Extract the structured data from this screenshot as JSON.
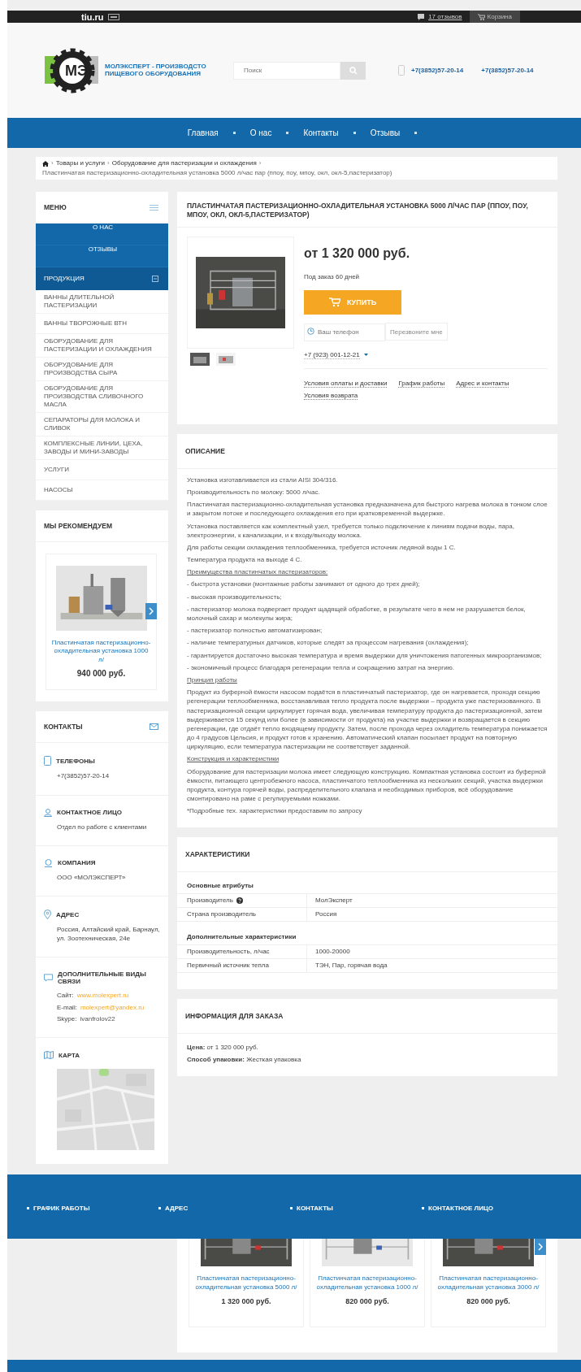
{
  "topbar": {
    "logo": "tiu.ru",
    "reviews": "17 отзывов",
    "cart": "Корзина"
  },
  "header": {
    "logo_letters": "МЭ",
    "company": "МОЛЭКСПЕРТ - ПРОИЗВОДСТО ПИЩЕВОГО ОБОРУДОВАНИЯ",
    "search": {
      "placeholder": "Поиск"
    },
    "phones": [
      "+7(3852)57-20-14",
      "+7(3852)57-20-14"
    ]
  },
  "nav": [
    "Главная",
    "О нас",
    "Контакты",
    "Отзывы"
  ],
  "breadcrumb": {
    "separator": "›",
    "items": [
      "Товары и услуги",
      "Оборудование для пастеризации и охлаждения",
      "Пластинчатая пастеризационно-охладительная установка 5000 л/час пар (ппоу, поу, мпоу, окл, окл-5,пастеризатор)"
    ]
  },
  "menu": {
    "title": "МЕНЮ",
    "items": [
      {
        "label": "О НАС",
        "kind": "main"
      },
      {
        "label": "ОТЗЫВЫ",
        "kind": "main"
      },
      {
        "label": "ПРОДУКЦИЯ",
        "kind": "group",
        "expanded": true
      },
      {
        "label": "ВАННЫ ДЛИТЕЛЬНОЙ ПАСТЕРИЗАЦИИ",
        "kind": "sub"
      },
      {
        "label": "ВАННЫ ТВОРОЖНЫЕ ВТН",
        "kind": "sub"
      },
      {
        "label": "ОБОРУДОВАНИЕ ДЛЯ ПАСТЕРИЗАЦИИ И ОХЛАЖДЕНИЯ",
        "kind": "sub"
      },
      {
        "label": "ОБОРУДОВАНИЕ ДЛЯ ПРОИЗВОДСТВА СЫРА",
        "kind": "sub"
      },
      {
        "label": "ОБОРУДОВАНИЕ ДЛЯ ПРОИЗВОДСТВА СЛИВОЧНОГО МАСЛА",
        "kind": "sub"
      },
      {
        "label": "СЕПАРАТОРЫ ДЛЯ МОЛОКА И СЛИВОК",
        "kind": "sub"
      },
      {
        "label": "КОМПЛЕКСНЫЕ ЛИНИИ, ЦЕХА, ЗАВОДЫ И МИНИ-ЗАВОДЫ",
        "kind": "sub"
      },
      {
        "label": "УСЛУГИ",
        "kind": "sub"
      },
      {
        "label": "НАСОСЫ",
        "kind": "sub"
      }
    ]
  },
  "recommend": {
    "title": "МЫ РЕКОМЕНДУЕМ",
    "product": {
      "title": "Пластинчатая пастеризационно-охладительная установка 1000 л/",
      "price": "940 000 руб."
    }
  },
  "contacts": {
    "title": "КОНТАКТЫ",
    "sections": [
      {
        "kind": "phone",
        "title": "ТЕЛЕФОНЫ",
        "lines": [
          "+7(3852)57-20-14"
        ]
      },
      {
        "kind": "person",
        "title": "КОНТАКТНОЕ ЛИЦО",
        "lines": [
          "Отдел по работе с клиентами"
        ]
      },
      {
        "kind": "company",
        "title": "КОМПАНИЯ",
        "lines": [
          "ООО «МОЛЭКСПЕРТ»"
        ]
      },
      {
        "kind": "address",
        "title": "АДРЕС",
        "lines": [
          "Россия, Алтайский край, Барнаул, ул. Зоотехническая, 24е"
        ]
      },
      {
        "kind": "chat",
        "title": "ДОПОЛНИТЕЛЬНЫЕ ВИДЫ СВЯЗИ",
        "links": [
          {
            "label": "Сайт:",
            "value": "www.molexpert.ru",
            "plain": false
          },
          {
            "label": "E-mail:",
            "value": "molexpert@yandex.ru",
            "plain": false
          },
          {
            "label": "Skype:",
            "value": "ivanfrolov22",
            "plain": true
          }
        ]
      },
      {
        "kind": "map",
        "title": "КАРТА"
      }
    ]
  },
  "product": {
    "title": "ПЛАСТИНЧАТАЯ ПАСТЕРИЗАЦИОННО-ОХЛАДИТЕЛЬНАЯ УСТАНОВКА 5000 Л/ЧАС ПАР (ППОУ, ПОУ, МПОУ, ОКЛ, ОКЛ-5,ПАСТЕРИЗАТОР)",
    "price": "от 1 320 000 руб.",
    "availability": "Под заказ 60 дней",
    "buy": "КУПИТЬ",
    "phone_field": {
      "placeholder": "Ваш телефон"
    },
    "callback": "Перезвоните мне",
    "phone": "+7 (923) 001-12-21",
    "links": [
      "Условия оплаты и доставки",
      "График работы",
      "Адрес и контакты",
      "Условия возврата"
    ]
  },
  "description": {
    "title": "ОПИСАНИЕ",
    "paragraphs": [
      {
        "kind": "text",
        "text": "Установка изготавливается из стали AISI 304/316."
      },
      {
        "kind": "text",
        "text": "Производительность по молоку: 5000 л/час."
      },
      {
        "kind": "text",
        "text": "Пластинчатая пастеризационно-охладительная установка предназначена для быстрого нагрева молока в тонком слое и закрытом потоке и последующего охлаждения его при кратковременной выдержке."
      },
      {
        "kind": "text",
        "text": "Установка поставляется как комплектный узел, требуется только подключение к линиям подачи воды, пара, электроэнергии, к канализации, и к входу/выходу молока."
      },
      {
        "kind": "text",
        "text": "Для работы секции охлаждения теплообменника, требуется источник ледяной воды 1 С."
      },
      {
        "kind": "text",
        "text": "Температура продукта на выходе 4 С."
      },
      {
        "kind": "heading",
        "text": "Преимущества пластинчатых пастеризаторов:"
      },
      {
        "kind": "text",
        "text": "- быстрота установки (монтажные работы занимают от одного до трех дней);"
      },
      {
        "kind": "text",
        "text": "- высокая производительность;"
      },
      {
        "kind": "text",
        "text": "- пастеризатор молока подвергает продукт щадящей обработке, в результате чего в нем не разрушается белок, молочный сахар и молекулы жира;"
      },
      {
        "kind": "text",
        "text": "- пастеризатор полностью автоматизирован;"
      },
      {
        "kind": "text",
        "text": "- наличие температурных датчиков, которые следят за процессом нагревания (охлаждения);"
      },
      {
        "kind": "text",
        "text": "- гарантируется достаточно высокая температура и время выдержки для уничтожения патогенных микроорганизмов;"
      },
      {
        "kind": "text",
        "text": "- экономичный процесс благодаря регенерации тепла и сокращению затрат на энергию."
      },
      {
        "kind": "heading",
        "text": "Принцип работы"
      },
      {
        "kind": "text",
        "text": "Продукт из буферной ёмкости насосом подаётся в пластинчатый пастеризатор, где он нагревается, проходя секцию регенерации теплообменника, восстанавливая тепло продукта после выдержки – продукта уже пастеризованного. В пастеризационной секции циркулирует горячая вода, увеличивая температуру продукта до пастеризационной, затем выдерживается 15 секунд или более (в зависимости от продукта) на участке выдержки и возвращается в секцию регенерации, где отдаёт тепло входящему продукту. Затем, после прохода через охладитель температура понижается до 4 градусов Цельсия, и продукт готов к хранению. Автоматический клапан посылает продукт на повторную циркуляцию, если температура пастеризации не соответствует заданной."
      },
      {
        "kind": "heading",
        "text": "Конструкция и характеристики"
      },
      {
        "kind": "text",
        "text": "Оборудование для пастеризации молока имеет следующую конструкцию. Компактная установка состоит из буферной ёмкости, питающего центробежного насоса, пластинчатого теплообменника из нескольких секций, участка выдержки продукта, контура горячей воды, распределительного клапана и необходимых приборов, всё оборудование смонтировано на раме с регулируемыми ножками."
      },
      {
        "kind": "text",
        "text": "*Подробные тех. характеристики предоставим по запросу"
      }
    ]
  },
  "characteristics": {
    "title": "ХАРАКТЕРИСТИКИ",
    "groups": [
      {
        "title": "Основные атрибуты",
        "rows": [
          {
            "name": "Производитель",
            "value": "МолЭксперт",
            "help": true
          },
          {
            "name": "Страна производитель",
            "value": "Россия",
            "help": false
          }
        ]
      },
      {
        "title": "Дополнительные характеристики",
        "rows": [
          {
            "name": "Производительность, л/час",
            "value": "1000-20000",
            "help": false
          },
          {
            "name": "Первичный источник тепла",
            "value": "ТЭН, Пар, горячая вода",
            "help": false
          }
        ]
      }
    ]
  },
  "order_info": {
    "title": "ИНФОРМАЦИЯ ДЛЯ ЗАКАЗА",
    "lines": [
      "**Цена:** от 1 320 000 руб.",
      "**Способ упаковки:** Жесткая упаковка"
    ]
  },
  "footer": [
    "ГРАФИК РАБОТЫ",
    "АДРЕС",
    "КОНТАКТЫ",
    "КОНТАКТНОЕ ЛИЦО"
  ],
  "similar": [
    {
      "title": "Пластинчатая пастеризационно-охладительная установка 5000 л/",
      "price": "1 320 000 руб."
    },
    {
      "title": "Пластинчатая пастеризационно-охладительная установка 1000 л/",
      "price": "820 000 руб."
    },
    {
      "title": "Пластинчатая пастеризационно-охладительная установка 3000 л/",
      "price": "820 000 руб."
    }
  ]
}
